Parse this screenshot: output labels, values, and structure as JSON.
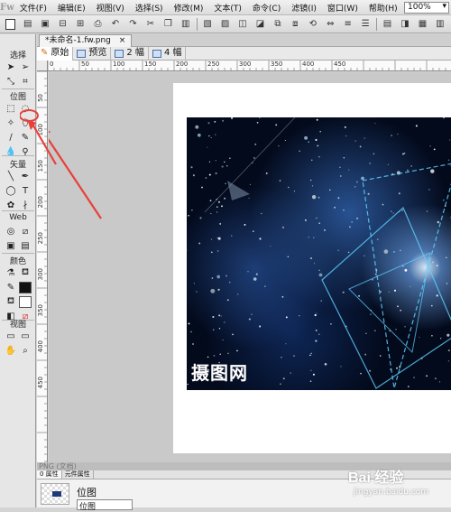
{
  "app": {
    "logo": "Fw"
  },
  "menu": {
    "items": [
      "文件(F)",
      "编辑(E)",
      "视图(V)",
      "选择(S)",
      "修改(M)",
      "文本(T)",
      "命令(C)",
      "滤镜(I)",
      "窗口(W)",
      "帮助(H)"
    ],
    "zoom": "100%"
  },
  "document": {
    "tab_title": "*未命名-1.fw.png",
    "close_glyph": "×"
  },
  "views": {
    "original": "原始",
    "preview": "预览",
    "two_up": "2 幅",
    "four_up": "4 幅"
  },
  "tools": {
    "select_title": "选择",
    "bitmap_title": "位图",
    "vector_title": "矢量",
    "web_title": "Web",
    "color_title": "颜色",
    "view_title": "视图"
  },
  "ruler": {
    "top_labels": [
      "0",
      "50",
      "100",
      "150",
      "200",
      "250",
      "300",
      "350",
      "400",
      "450"
    ],
    "left_labels": [
      "50",
      "100",
      "150",
      "200",
      "250",
      "300",
      "350",
      "400",
      "450"
    ]
  },
  "artwork": {
    "watermark": "摄图网"
  },
  "bottom": {
    "status": "PNG (文档)",
    "tabs": [
      "0 属性",
      "元件属性"
    ],
    "layer_name": "位图",
    "layer_field": "位图"
  },
  "brand": {
    "logo": "Bai 经验",
    "url": "jingyan.baidu.com"
  },
  "colors": {
    "annotation": "#e8403a",
    "stroke": "#111111",
    "fill": "#ffffff"
  }
}
